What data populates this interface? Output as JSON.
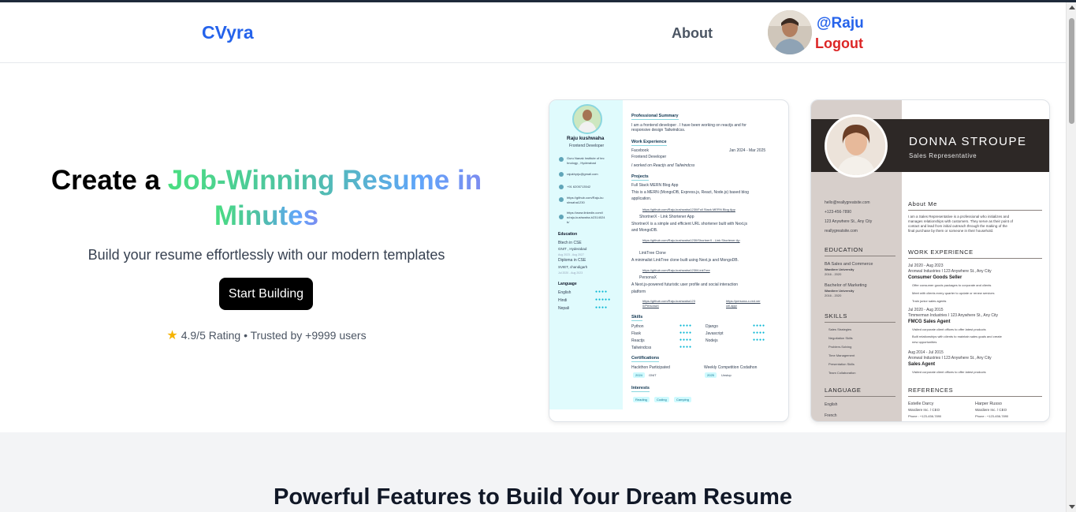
{
  "nav": {
    "logo": "CVyra",
    "about": "About",
    "username": "@Raju",
    "logout": "Logout"
  },
  "hero": {
    "headline_plain": "Create a ",
    "headline_gradient_1": "Job-Winning Resume in",
    "headline_gradient_2": "Minutes",
    "subtitle": "Build your resume effortlessly with our modern templates",
    "cta": "Start Building",
    "rating": "4.9/5 Rating • Trusted by +9999 users"
  },
  "resume1": {
    "name": "Raju kushwaha",
    "role": "Frontend Developer",
    "contact": [
      "Guru Nanak Institute of tec",
      "hnology , Hyderabad",
      "rajukhyrju@gmail.com",
      "+91 6205713542",
      "https://github.com/Raju-ku",
      "shwaha1230",
      "https://www.linkedin.com/i",
      "n/raju-kushwaha-b2314024",
      "b/"
    ],
    "education_title": "Education",
    "education": [
      "Btech in CSE",
      "GNIT , Hyderabad",
      "Aug 2023 - Aug 2027",
      "Diploma in CSE",
      "SVIET, chandigarh",
      "Jul 2020 - Aug 2023"
    ],
    "language_title": "Language",
    "languages": [
      "English",
      "Hindi",
      "Nepali"
    ],
    "summary_title": "Professional Summary",
    "summary": [
      "I am a frontend developer . I have been working on reactjs and for",
      "responsive design Tailwindcss."
    ],
    "work_title": "Work Experience",
    "work_company": "Facebook",
    "work_dates": "Jan 2024 - Mar 2025",
    "work_role": "Frontend Developer",
    "work_desc": "I worked on Reactjs and Tailwindcss",
    "projects_title": "Projects",
    "projects": [
      "Full Stack MERN Blog App",
      "This is a MERN (MongoDB, Express.js, React, Node.js) based blog",
      "application.",
      "https://github.com/Raju-kushwaha1230/Full Stack MERN Blog App",
      "ShortnerX - Link Shortener App",
      "ShortnerX is a simple and efficient URL shortener built with Next.js",
      "and MongoDB.",
      "https://github.com/Raju-kushwaha1230/ShortnerX - Link Shortener Ap",
      "LinkTree Clone",
      "A minimalist LinkTree clone built using Next.js and MongoDB.",
      "https://github.com/Raju-kushwaha1230/LinkTree",
      "PersonaX",
      "A Next.js-powered futuristic user profile and social interaction",
      "platform",
      "https://github.com/Raju-kushwaha123",
      "0/PersonaX",
      "https://persona-x-red.ver",
      "cel.app/"
    ],
    "skills_title": "Skills",
    "skills": [
      "Python",
      "Flask",
      "Reactjs",
      "Tailwindcss",
      "Django",
      "Javascript",
      "Nodejs"
    ],
    "cert_title": "Certifications",
    "certs": [
      "Hackthon Participated",
      "2024",
      "GNIT",
      "Weekly Competition Codathon",
      "2025",
      "Unstop"
    ],
    "interests_title": "Interests",
    "interests": [
      "Reading",
      "Coding",
      "Camping"
    ]
  },
  "resume2": {
    "name": "DONNA STROUPE",
    "role": "Sales Representative",
    "contact": [
      "hello@reallygreatsite.com",
      "+123-456-7890",
      "123 Anywhere St., Any City",
      "reallygreatsite.com"
    ],
    "education_title": "EDUCATION",
    "education": [
      "BA Sales and Commerce",
      "Wardiere University",
      "2016 - 2020",
      "Bachelor of Marketing",
      "Wardiere University",
      "2016 - 2020"
    ],
    "skills_title": "SKILLS",
    "skills": [
      "Sales Strategies",
      "Negotiation Skills",
      "Problem-Solving",
      "Time Management",
      "Presentation Skills",
      "Team Collaboration"
    ],
    "language_title": "LANGUAGE",
    "languages": [
      "English",
      "French"
    ],
    "about_title": "About Me",
    "about": [
      "I am a Sales Representative is a professional who initializes and",
      "manages relationships with customers. They serve as their point of",
      "contact and lead from initial outreach through the making of the",
      "final purchase by them or someone in their household."
    ],
    "work_title": "WORK EXPERIENCE",
    "work": [
      "Jul 2020 - Aug 2023",
      "Aronwal Industries I 123 Anywhere St., Any City",
      "Consumer Goods Seller",
      "Offer consumer goods packages to corporate and clients",
      "Meet with clients every quarter to update or renew services",
      "Train junior sales agents",
      "Jul 2020 - Aug 2015",
      "Timmerman Industries I 123 Anywhere St., Any City",
      "FMCG Sales Agent",
      "Visited corporate client offices to offer latest products",
      "Built relationships with clients to maintain sales goals and create",
      "new opportunities",
      "Aug 2014 - Jul 2015",
      "Aronwal Industries I 123 Anywhere St., Any City",
      "Sales Agent",
      "Visited corporate client offices to offer latest products"
    ],
    "references_title": "REFERENCES",
    "references": [
      "Estelle Darcy",
      "Wardiere Inc. / CEO",
      "Phone : +123-456-7890",
      "Harper Russo",
      "Wardiere Inc. / CEO",
      "Phone : +123-456-7890"
    ]
  },
  "features": {
    "title": "Powerful Features to Build Your Dream Resume"
  }
}
